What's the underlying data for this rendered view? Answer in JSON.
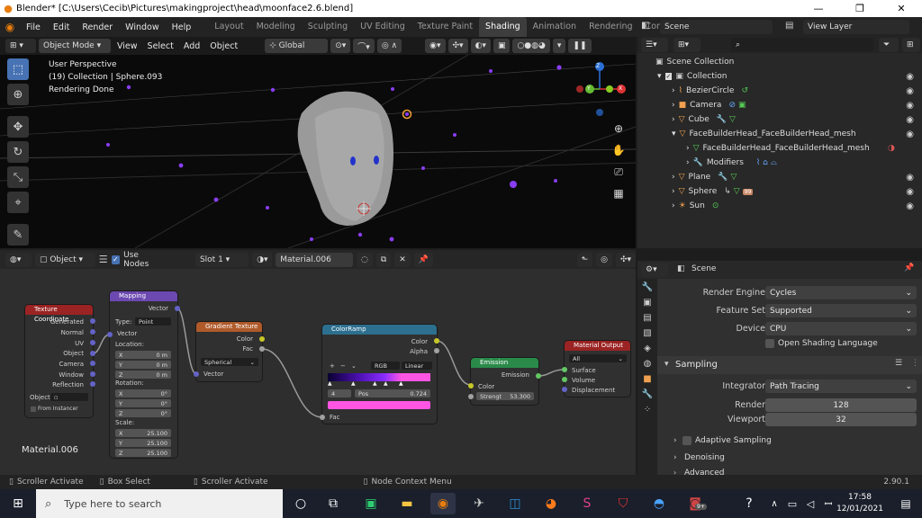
{
  "titlebar": {
    "title": "Blender* [C:\\Users\\Cecib\\Pictures\\makingproject\\head\\moonface2.6.blend]",
    "min": "—",
    "max": "❐",
    "close": "✕"
  },
  "menu": [
    "File",
    "Edit",
    "Render",
    "Window",
    "Help"
  ],
  "workspaces": [
    "Layout",
    "Modeling",
    "Sculpting",
    "UV Editing",
    "Texture Paint",
    "Shading",
    "Animation",
    "Rendering",
    "Compos"
  ],
  "active_workspace": "Shading",
  "scene": {
    "label": "Scene",
    "view_layer": "View Layer"
  },
  "viewport": {
    "mode": "Object Mode",
    "menus": [
      "View",
      "Select",
      "Add",
      "Object"
    ],
    "orientation": "Global",
    "info_line1": "User Perspective",
    "info_line2": "(19) Collection | Sphere.093",
    "info_line3": "Rendering Done",
    "gizmo": {
      "x": "X",
      "y": "Y",
      "z": "Z"
    }
  },
  "outliner": {
    "search_placeholder": "",
    "rows": [
      {
        "label": "Scene Collection",
        "indent": 0
      },
      {
        "label": "Collection",
        "indent": 1
      },
      {
        "label": "BezierCircle",
        "indent": 2
      },
      {
        "label": "Camera",
        "indent": 2
      },
      {
        "label": "Cube",
        "indent": 2
      },
      {
        "label": "FaceBuilderHead_FaceBuilderHead_mesh",
        "indent": 2
      },
      {
        "label": "FaceBuilderHead_FaceBuilderHead_mesh",
        "indent": 3
      },
      {
        "label": "Modifiers",
        "indent": 3
      },
      {
        "label": "Plane",
        "indent": 2
      },
      {
        "label": "Sphere",
        "indent": 2
      },
      {
        "label": "Sun",
        "indent": 2
      }
    ],
    "sphere_badge": "99"
  },
  "node_header": {
    "type": "Object",
    "use_nodes": "Use Nodes",
    "slot": "Slot 1",
    "material": "Material.006"
  },
  "nodes": {
    "texcoord": {
      "title": "Texture Coordinate",
      "outputs": [
        "Generated",
        "Normal",
        "UV",
        "Object",
        "Camera",
        "Window",
        "Reflection"
      ],
      "object_label": "Object",
      "from_instancer": "From Instancer"
    },
    "mapping": {
      "title": "Mapping",
      "vector_out": "Vector",
      "type_label": "Type:",
      "type_value": "Point",
      "vector_in": "Vector",
      "location": "Location:",
      "rotation": "Rotation:",
      "scale": "Scale:",
      "loc": [
        {
          "axis": "X",
          "v": "0 m"
        },
        {
          "axis": "Y",
          "v": "0 m"
        },
        {
          "axis": "Z",
          "v": "0 m"
        }
      ],
      "rot": [
        {
          "axis": "X",
          "v": "0°"
        },
        {
          "axis": "Y",
          "v": "0°"
        },
        {
          "axis": "Z",
          "v": "0°"
        }
      ],
      "scl": [
        {
          "axis": "X",
          "v": "25.100"
        },
        {
          "axis": "Y",
          "v": "25.100"
        },
        {
          "axis": "Z",
          "v": "25.100"
        }
      ]
    },
    "gradient": {
      "title": "Gradient Texture",
      "color": "Color",
      "fac": "Fac",
      "mode": "Spherical",
      "vector": "Vector"
    },
    "colorramp": {
      "title": "ColorRamp",
      "color": "Color",
      "alpha": "Alpha",
      "mode1": "RGB",
      "mode2": "Linear",
      "index": "4",
      "pos_label": "Pos",
      "pos": "0.724",
      "fac": "Fac",
      "plus": "+",
      "minus": "−"
    },
    "emission": {
      "title": "Emission",
      "emission": "Emission",
      "color": "Color",
      "strength_label": "Strengt",
      "strength": "53.300"
    },
    "output": {
      "title": "Material Output",
      "target": "All",
      "surface": "Surface",
      "volume": "Volume",
      "displacement": "Displacement"
    }
  },
  "node_material_label": "Material.006",
  "properties": {
    "scene": "Scene",
    "render_engine_label": "Render Engine",
    "render_engine": "Cycles",
    "feature_set_label": "Feature Set",
    "feature_set": "Supported",
    "device_label": "Device",
    "device": "CPU",
    "osl": "Open Shading Language",
    "sampling": "Sampling",
    "integrator_label": "Integrator",
    "integrator": "Path Tracing",
    "render_label": "Render",
    "render": "128",
    "viewport_label": "Viewport",
    "viewport": "32",
    "adaptive": "Adaptive Sampling",
    "denoising": "Denoising",
    "advanced": "Advanced"
  },
  "status": {
    "left1": "Scroller Activate",
    "left2": "Box Select",
    "left3": "Scroller Activate",
    "mid": "Node Context Menu",
    "version": "2.90.1"
  },
  "taskbar": {
    "search_placeholder": "Type here to search",
    "time": "17:58",
    "date": "12/01/2021",
    "badge": "9+"
  },
  "colors": {
    "accent": "#4772b3",
    "blender_orange": "#e87d0d",
    "colorramp_pink": "#ff55e3"
  }
}
